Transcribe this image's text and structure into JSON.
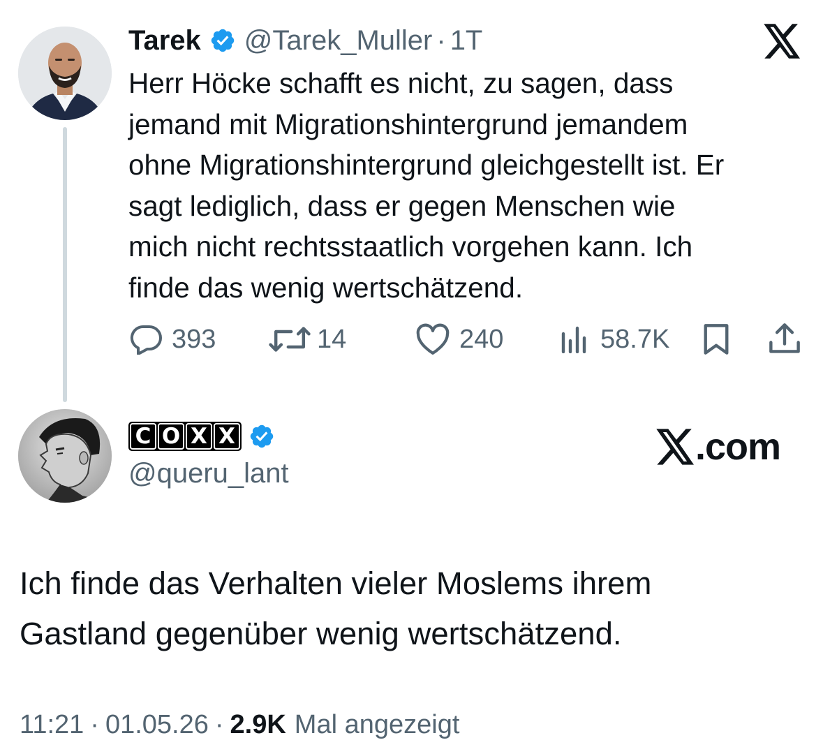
{
  "parent_tweet": {
    "author_name": "Tarek",
    "verified": true,
    "handle": "@Tarek_Muller",
    "separator": "·",
    "age": "1T",
    "text": "Herr Höcke schafft es nicht, zu sagen, dass\njemand mit Migrationshintergrund jemandem\nohne Migrationshintergrund gleichgestellt ist. Er\nsagt lediglich, dass er gegen Menschen wie\nmich nicht rechtsstaatlich vorgehen kann. Ich\nfinde das wenig wertschätzend.",
    "metrics": {
      "replies": "393",
      "reposts": "14",
      "likes": "240",
      "views": "58.7K"
    },
    "icons": [
      "reply-icon",
      "repost-icon",
      "like-icon",
      "views-icon",
      "bookmark-icon",
      "share-icon"
    ]
  },
  "reply_tweet": {
    "author_name_letters": [
      "C",
      "O",
      "X",
      "X"
    ],
    "verified": true,
    "handle": "@queru_lant",
    "text": "Ich finde das Verhalten vieler Moslems ihrem\nGastland gegenüber wenig wertschätzend.",
    "time": "11:21",
    "date": "01.05.26",
    "views_count": "2.9K",
    "views_label": "Mal angezeigt",
    "separator": "·"
  },
  "branding": {
    "watermark_suffix": ".com"
  },
  "colors": {
    "text_primary": "#0f1419",
    "text_secondary": "#536471",
    "verified_blue": "#1d9bf0",
    "thread_line": "#cfd9de",
    "background": "#ffffff"
  }
}
